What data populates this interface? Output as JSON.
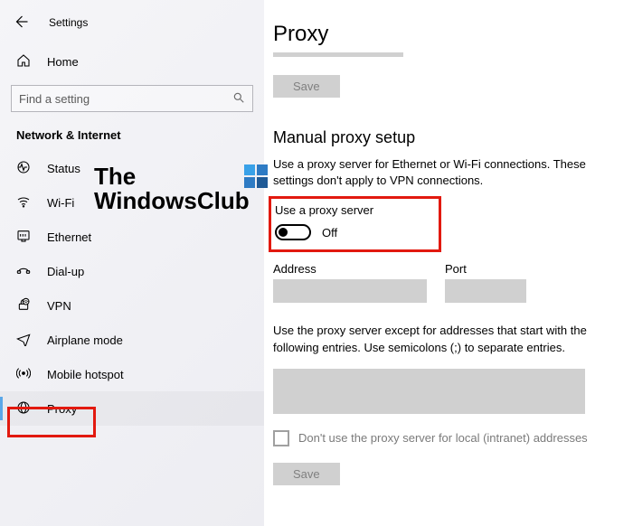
{
  "header": {
    "title": "Settings"
  },
  "home": {
    "label": "Home"
  },
  "search": {
    "placeholder": "Find a setting"
  },
  "category": {
    "title": "Network & Internet"
  },
  "nav": [
    {
      "label": "Status",
      "icon": "status-icon"
    },
    {
      "label": "Wi-Fi",
      "icon": "wifi-icon"
    },
    {
      "label": "Ethernet",
      "icon": "ethernet-icon"
    },
    {
      "label": "Dial-up",
      "icon": "dialup-icon"
    },
    {
      "label": "VPN",
      "icon": "vpn-icon"
    },
    {
      "label": "Airplane mode",
      "icon": "airplane-icon"
    },
    {
      "label": "Mobile hotspot",
      "icon": "hotspot-icon"
    },
    {
      "label": "Proxy",
      "icon": "proxy-icon"
    }
  ],
  "page": {
    "title": "Proxy",
    "save": "Save",
    "section_title": "Manual proxy setup",
    "description": "Use a proxy server for Ethernet or Wi-Fi connections. These settings don't apply to VPN connections.",
    "toggle_label": "Use a proxy server",
    "toggle_state": "Off",
    "address_label": "Address",
    "port_label": "Port",
    "except_desc": "Use the proxy server except for addresses that start with the following entries. Use semicolons (;) to separate entries.",
    "checkbox_label": "Don't use the proxy server for local (intranet) addresses",
    "save2": "Save"
  },
  "watermark": {
    "line1": "The",
    "line2": "WindowsClub"
  }
}
